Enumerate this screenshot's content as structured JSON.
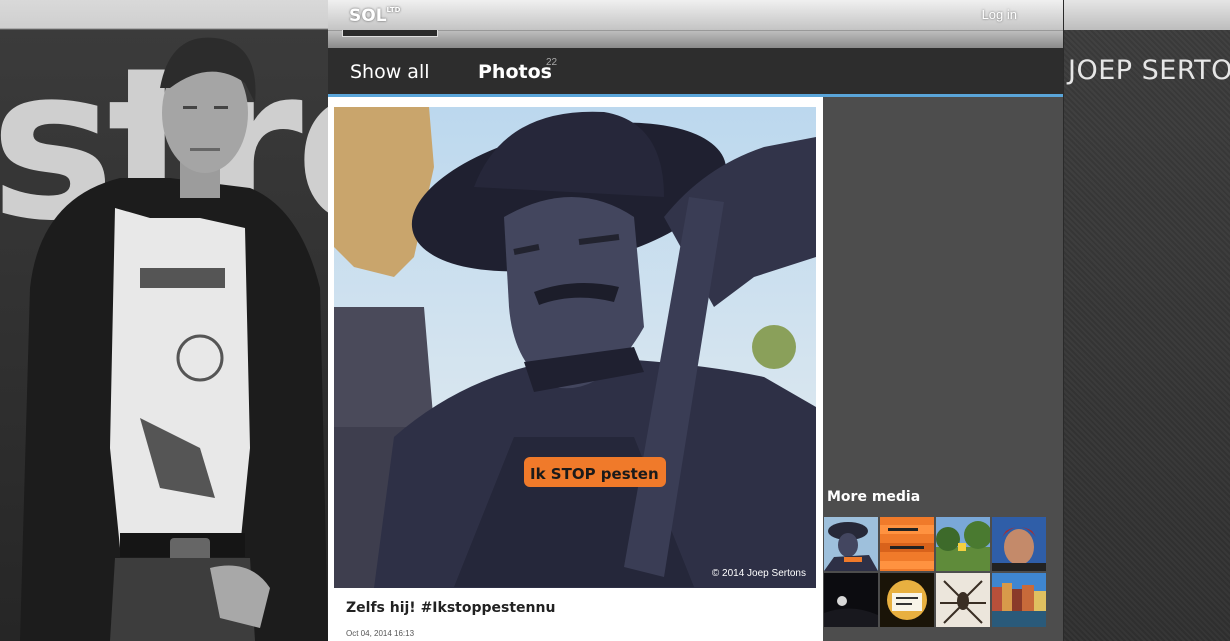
{
  "header": {
    "logo": "SOL",
    "logo_sup": "LTD",
    "login_label": "Log in"
  },
  "profile": {
    "name": "JOEP SERTON"
  },
  "nav": {
    "tabs": [
      {
        "label": "Show all",
        "active": false
      },
      {
        "label": "Photos",
        "active": true
      }
    ],
    "photos_count": "22"
  },
  "photo": {
    "caption": "Zelfs hij! #Ikstoppestennu",
    "date": "Oct 04, 2014 16:13",
    "copyright": "© 2014 Joep Sertons",
    "wristband_text": "Ik STOP pesten"
  },
  "more_media": {
    "title": "More media",
    "thumbnails": [
      {
        "icon": "statue-thumbnail"
      },
      {
        "icon": "stop-pesten-bands-thumbnail"
      },
      {
        "icon": "park-thumbnail"
      },
      {
        "icon": "selfie-thumbnail"
      },
      {
        "icon": "night-moon-thumbnail"
      },
      {
        "icon": "sign-thumbnail"
      },
      {
        "icon": "spider-thumbnail"
      },
      {
        "icon": "canal-houses-thumbnail"
      }
    ]
  },
  "background": {
    "left_text": "strd"
  },
  "colors": {
    "accent": "#5aa5d9",
    "nav_bg": "#2d2d2d",
    "wristband": "#f07a2a"
  }
}
